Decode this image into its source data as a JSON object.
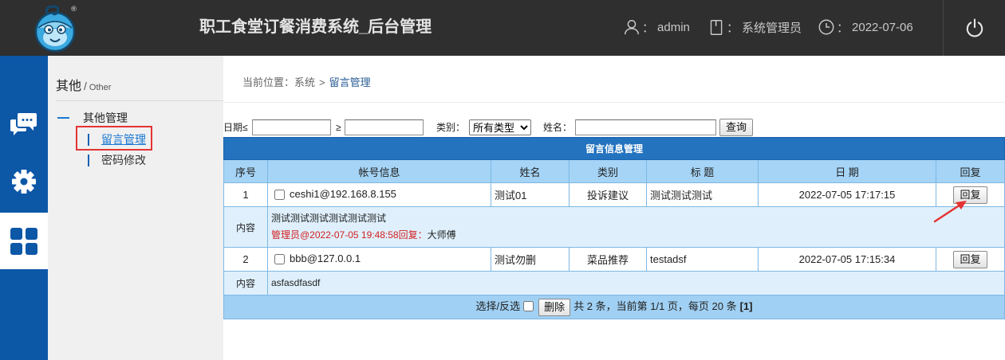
{
  "header": {
    "app_title": "职工食堂订餐消费系统_后台管理",
    "logo_icon": "chef-mascot-logo",
    "logo_mark": "®",
    "user": {
      "icon": "user-icon",
      "colon": "：",
      "name": "admin"
    },
    "role": {
      "icon": "document-icon",
      "colon": "：",
      "name": "系统管理员"
    },
    "date": {
      "icon": "clock-icon",
      "colon": "：",
      "value": "2022-07-06"
    },
    "logout_icon": "power-icon"
  },
  "icon_nav": [
    {
      "icon": "chat-icon",
      "active": false
    },
    {
      "icon": "gear-icon",
      "active": false
    },
    {
      "icon": "grid-icon",
      "active": true
    }
  ],
  "sidebar": {
    "heading": "其他",
    "heading_sep": "/",
    "heading_en": "Other",
    "group_label": "其他管理",
    "items": [
      {
        "label": "留言管理",
        "active": true
      },
      {
        "label": "密码修改",
        "active": false
      }
    ]
  },
  "breadcrumb": {
    "prefix": "当前位置：",
    "root": "系统",
    "sep": ">",
    "current": "留言管理"
  },
  "filters": {
    "date_le_label": "日期≤",
    "date_le_value": "",
    "date_ge_label": "≥",
    "date_ge_value": "",
    "category_label": "类别：",
    "category_selected": "所有类型",
    "name_label": "姓名：",
    "name_value": "",
    "query_button": "查询"
  },
  "table": {
    "title": "留言信息管理",
    "columns": [
      "序号",
      "帐号信息",
      "姓名",
      "类别",
      "标 题",
      "日 期",
      "回复"
    ],
    "rows": [
      {
        "index": "1",
        "account": "ceshi1@192.168.8.155",
        "name": "测试01",
        "category": "投诉建议",
        "subject": "测试测试测试",
        "date": "2022-07-05 17:17:15",
        "reply_button": "回复",
        "content_label": "内容",
        "content": "测试测试测试测试测试测试",
        "reply_meta": "管理员@2022-07-05 19:48:58回复：",
        "reply_text": "大师傅"
      },
      {
        "index": "2",
        "account": "bbb@127.0.0.1",
        "name": "测试勿删",
        "category": "菜品推荐",
        "subject": "testadsf",
        "date": "2022-07-05 17:15:34",
        "reply_button": "回复",
        "content_label": "内容",
        "content": "asfasdfasdf"
      }
    ],
    "footer": {
      "select_label": "选择/反选",
      "delete_button": "删除",
      "summary": "共 2 条，当前第 1/1 页，每页 20 条",
      "page": "[1]"
    }
  },
  "colors": {
    "header_bg": "#2f2f2f",
    "nav_bg": "#0d57a7",
    "sidebar_bg": "#f0f0f0",
    "link_blue": "#1a78d4",
    "table_title_bg": "#2373bf",
    "table_header_bg": "#a5d4f6",
    "content_row_bg": "#dff0fc",
    "footer_bg": "#a0d0f3",
    "grid_border": "#7db7e3",
    "reply_red": "#d42020",
    "annotation_red": "#e53333"
  }
}
